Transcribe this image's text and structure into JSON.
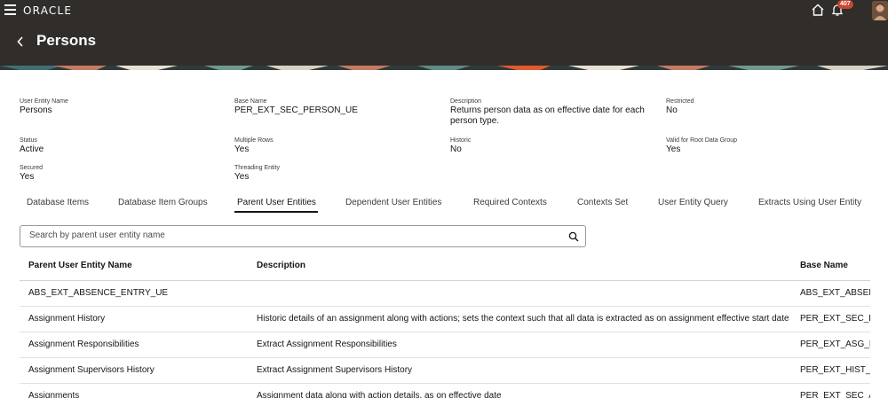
{
  "topbar": {
    "brand": "ORACLE",
    "notification_count": "407"
  },
  "header": {
    "title": "Persons"
  },
  "details": {
    "user_entity_name": {
      "label": "User Entity Name",
      "value": "Persons"
    },
    "base_name": {
      "label": "Base Name",
      "value": "PER_EXT_SEC_PERSON_UE"
    },
    "description": {
      "label": "Description",
      "value_line1": "Returns person data as on effective date for each",
      "value_line2": "person type."
    },
    "restricted": {
      "label": "Restricted",
      "value": "No"
    },
    "status": {
      "label": "Status",
      "value": "Active"
    },
    "multiple_rows": {
      "label": "Multiple Rows",
      "value": "Yes"
    },
    "historic": {
      "label": "Historic",
      "value": "No"
    },
    "valid_for_root": {
      "label": "Valid for Root Data Group",
      "value": "Yes"
    },
    "secured": {
      "label": "Secured",
      "value": "Yes"
    },
    "threading_entity": {
      "label": "Threading Entity",
      "value": "Yes"
    }
  },
  "tabs": [
    {
      "label": "Database Items"
    },
    {
      "label": "Database Item Groups"
    },
    {
      "label": "Parent User Entities",
      "active": true
    },
    {
      "label": "Dependent User Entities"
    },
    {
      "label": "Required Contexts"
    },
    {
      "label": "Contexts Set"
    },
    {
      "label": "User Entity Query"
    },
    {
      "label": "Extracts Using User Entity"
    }
  ],
  "search": {
    "placeholder": "Search by parent user entity name",
    "value": ""
  },
  "table": {
    "headers": [
      "Parent User Entity Name",
      "Description",
      "Base Name"
    ],
    "rows": [
      {
        "name": "ABS_EXT_ABSENCE_ENTRY_UE",
        "description": "",
        "base_name": "ABS_EXT_ABSENC"
      },
      {
        "name": "Assignment History",
        "description": "Historic details of an assignment along with actions; sets the context such that all data is extracted as on assignment effective start date.",
        "base_name": "PER_EXT_SEC_HIS"
      },
      {
        "name": "Assignment Responsibilities",
        "description": "Extract Assignment Responsibilities",
        "base_name": "PER_EXT_ASG_RE"
      },
      {
        "name": "Assignment Supervisors History",
        "description": "Extract Assignment Supervisors History",
        "base_name": "PER_EXT_HIST_AS"
      },
      {
        "name": "Assignments",
        "description": "Assignment data along with action details, as on effective date",
        "base_name": "PER_EXT_SEC_AS"
      }
    ]
  },
  "colors": {
    "header_bg": "#312d2a",
    "badge": "#c74634"
  }
}
